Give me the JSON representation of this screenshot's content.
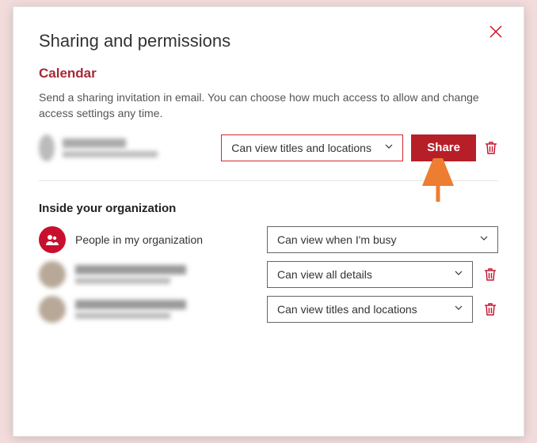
{
  "header": {
    "title": "Sharing and permissions"
  },
  "calendar": {
    "label": "Calendar",
    "description": "Send a sharing invitation in email. You can choose how much access to allow and change access settings any time."
  },
  "invite": {
    "name": "(obscured)",
    "email": "(obscured)",
    "permission": "Can view titles and locations",
    "share_label": "Share"
  },
  "section": {
    "title": "Inside your organization"
  },
  "org": {
    "label": "People in my organization",
    "permission": "Can view when I'm busy"
  },
  "rows": [
    {
      "name": "(obscured)",
      "email": "(obscured)",
      "permission": "Can view all details"
    },
    {
      "name": "(obscured)",
      "email": "(obscured)",
      "permission": "Can view titles and locations"
    }
  ],
  "colors": {
    "accent": "#c8102e",
    "button": "#b71f28",
    "arrow": "#ed7d31"
  }
}
